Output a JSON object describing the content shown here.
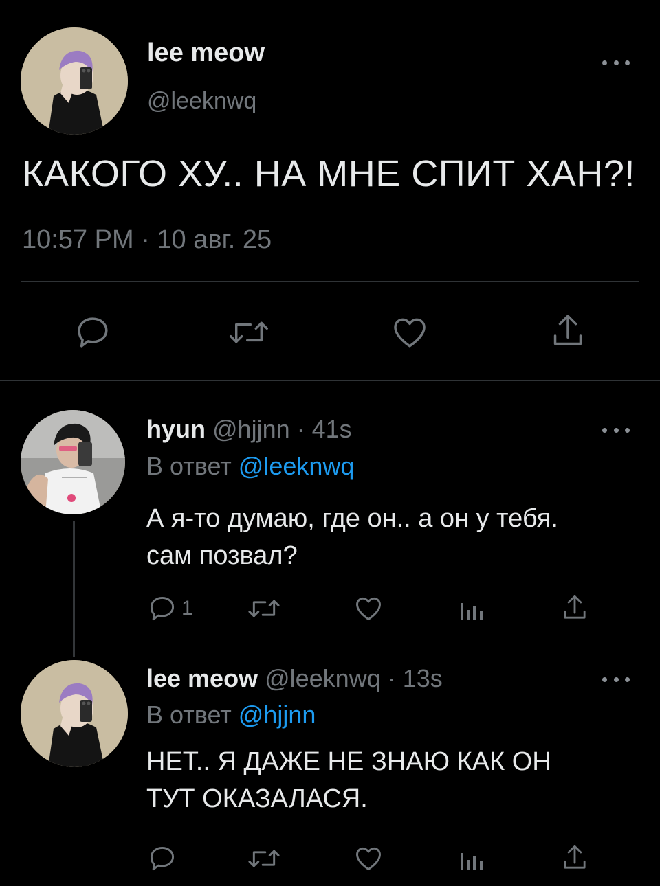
{
  "main_tweet": {
    "author_name": "lee meow",
    "handle": "@leeknwq",
    "text": "КАКОГО ХУ.. НА МНЕ СПИТ ХАН?!",
    "timestamp": "10:57 PM · 10 авг. 25",
    "actions": [
      "reply-icon",
      "retweet-icon",
      "like-icon",
      "share-icon"
    ]
  },
  "replies": [
    {
      "author_name": "hyun",
      "handle": "@hjjnn",
      "time": "· 41s",
      "reply_prefix": "В ответ",
      "reply_to": "@leeknwq",
      "text_line1": "А я-то думаю, где он.. а он у тебя.",
      "text_line2": "сам позвал?",
      "reply_count": "1"
    },
    {
      "author_name": "lee meow",
      "handle": "@leeknwq",
      "time": "· 13s",
      "reply_prefix": "В ответ",
      "reply_to": "@hjjnn",
      "text_line1": "НЕТ.. Я ДАЖЕ НЕ ЗНАЮ КАК ОН",
      "text_line2": "ТУТ ОКАЗАЛАСЯ.",
      "reply_count": ""
    }
  ],
  "colors": {
    "background": "#000000",
    "text": "#e7e9ea",
    "muted": "#71767b",
    "link": "#1d9bf0",
    "divider": "#2f3336"
  }
}
